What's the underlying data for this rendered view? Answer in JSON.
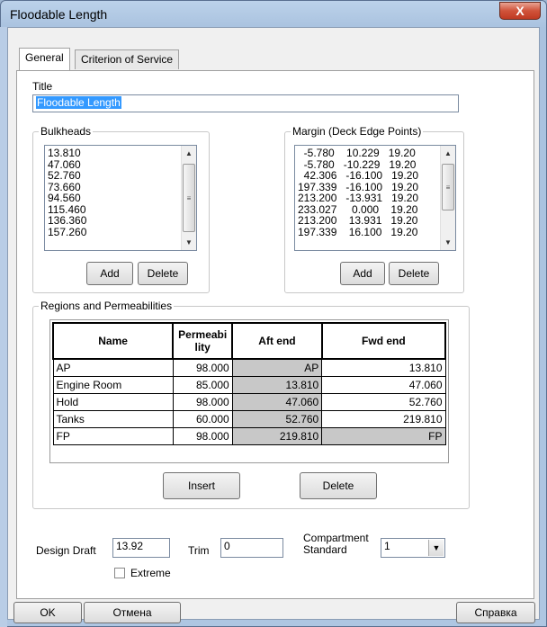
{
  "window": {
    "title": "Floodable Length",
    "close_glyph": "X"
  },
  "tabs": [
    {
      "label": "General",
      "active": true
    },
    {
      "label": "Criterion of Service",
      "active": false
    }
  ],
  "general": {
    "title_label": "Title",
    "title_value": "Floodable Length",
    "bulkheads": {
      "label": "Bulkheads",
      "items": [
        "13.810",
        "47.060",
        "52.760",
        "73.660",
        "94.560",
        "115.460",
        "136.360",
        "157.260"
      ],
      "add_label": "Add",
      "delete_label": "Delete"
    },
    "margin": {
      "label": "Margin (Deck Edge Points)",
      "items": [
        "  -5.780    10.229   19.20",
        "  -5.780   -10.229   19.20",
        "  42.306   -16.100   19.20",
        "197.339   -16.100   19.20",
        "213.200   -13.931   19.20",
        "233.027     0.000    19.20",
        "213.200    13.931   19.20",
        "197.339    16.100   19.20"
      ],
      "add_label": "Add",
      "delete_label": "Delete"
    },
    "regions": {
      "label": "Regions and Permeabilities",
      "headers": {
        "name": "Name",
        "perm1": "Permeabi",
        "perm2": "lity",
        "aft": "Aft end",
        "fwd": "Fwd end"
      },
      "rows": [
        {
          "name": "AP",
          "perm": "98.000",
          "aft": "AP",
          "fwd": "13.810"
        },
        {
          "name": "Engine Room",
          "perm": "85.000",
          "aft": "13.810",
          "fwd": "47.060"
        },
        {
          "name": "Hold",
          "perm": "98.000",
          "aft": "47.060",
          "fwd": "52.760"
        },
        {
          "name": "Tanks",
          "perm": "60.000",
          "aft": "52.760",
          "fwd": "219.810"
        },
        {
          "name": "FP",
          "perm": "98.000",
          "aft": "219.810",
          "fwd": "FP"
        }
      ],
      "insert_label": "Insert",
      "delete_label": "Delete"
    },
    "design_draft_label": "Design Draft",
    "design_draft_value": "13.92",
    "trim_label": "Trim",
    "trim_value": "0",
    "compartment_label_1": "Compartment",
    "compartment_label_2": "Standard",
    "compartment_value": "1",
    "extreme_label": "Extreme"
  },
  "footer": {
    "ok_label": "OK",
    "cancel_label": "Отмена",
    "help_label": "Справка"
  }
}
